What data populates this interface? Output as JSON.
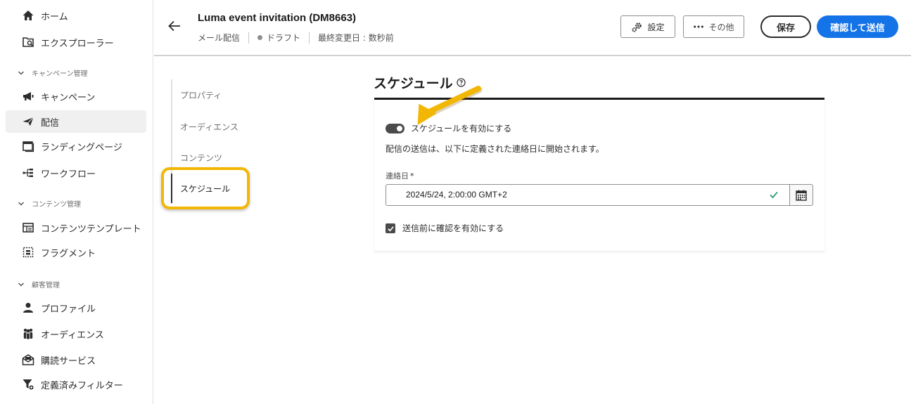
{
  "sidebar": {
    "items": [
      {
        "label": "ホーム"
      },
      {
        "label": "エクスプローラー"
      },
      {
        "label": "キャンペーン"
      },
      {
        "label": "配信"
      },
      {
        "label": "ランディングページ"
      },
      {
        "label": "ワークフロー"
      },
      {
        "label": "コンテンツテンプレート"
      },
      {
        "label": "フラグメント"
      },
      {
        "label": "プロファイル"
      },
      {
        "label": "オーディエンス"
      },
      {
        "label": "購読サービス"
      },
      {
        "label": "定義済みフィルター"
      }
    ],
    "sections": [
      {
        "label": "キャンペーン管理"
      },
      {
        "label": "コンテンツ管理"
      },
      {
        "label": "顧客管理"
      }
    ]
  },
  "header": {
    "title": "Luma event invitation (DM8663)",
    "channel": "メール配信",
    "status": "ドラフト",
    "modified": "最終変更日 : 数秒前",
    "settings_label": "設定",
    "more_label": "その他",
    "save_label": "保存",
    "send_label": "確認して送信"
  },
  "steps": [
    {
      "label": "プロパティ"
    },
    {
      "label": "オーディエンス"
    },
    {
      "label": "コンテンツ"
    },
    {
      "label": "スケジュール"
    }
  ],
  "schedule": {
    "title": "スケジュール",
    "toggle_label": "スケジュールを有効にする",
    "toggle_on": true,
    "description": "配信の送信は、以下に定義された連絡日に開始されます。",
    "field_label": "連絡日",
    "required_mark": "*",
    "date_value": "2024/5/24, 2:00:00 GMT+2",
    "confirm_label": "送信前に確認を有効にする",
    "confirm_checked": true
  },
  "colors": {
    "accent": "#1473e6",
    "highlight": "#f2b705",
    "valid": "#2d9d78"
  },
  "icons": [
    "home-icon",
    "explorer-icon",
    "campaign-icon",
    "delivery-icon",
    "landing-page-icon",
    "workflow-icon",
    "content-template-icon",
    "fragment-icon",
    "profile-icon",
    "audience-icon",
    "subscription-icon",
    "filter-icon",
    "gear-icon",
    "more-icon",
    "back-arrow-icon",
    "help-icon",
    "checkmark-icon",
    "calendar-icon"
  ]
}
